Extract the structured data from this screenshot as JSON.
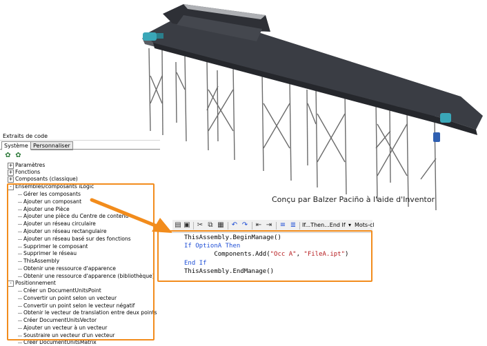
{
  "caption": "Conçu par Balzer Paciño à l'aide d'Inventor",
  "snippets_panel": {
    "title": "Extraits de code",
    "tabs": [
      "Système",
      "Personnaliser"
    ],
    "tree": [
      {
        "label": "Paramètres",
        "expander": "+"
      },
      {
        "label": "Fonctions",
        "expander": "+"
      },
      {
        "label": "Composants (classique)",
        "expander": "+"
      },
      {
        "label": "Ensembles/composants iLogic",
        "expander": "-"
      },
      {
        "label": "Gérer les composants"
      },
      {
        "label": "Ajouter un composant"
      },
      {
        "label": "Ajouter une Pièce"
      },
      {
        "label": "Ajouter une pièce du Centre de contenu"
      },
      {
        "label": "Ajouter un réseau circulaire"
      },
      {
        "label": "Ajouter un réseau rectangulaire"
      },
      {
        "label": "Ajouter un réseau basé sur des fonctions"
      },
      {
        "label": "Supprimer le composant"
      },
      {
        "label": "Supprimer le réseau"
      },
      {
        "label": "ThisAssembly"
      },
      {
        "label": "Obtenir une ressource d'apparence"
      },
      {
        "label": "Obtenir une ressource d'apparence (bibliothèque)"
      },
      {
        "label": "Positionnement",
        "expander": "-"
      },
      {
        "label": "Créer un DocumentUnitsPoint"
      },
      {
        "label": "Convertir un point selon un vecteur"
      },
      {
        "label": "Convertir un point selon le vecteur négatif"
      },
      {
        "label": "Obtenir le vecteur de translation entre deux points"
      },
      {
        "label": "Créer DocumentUnitsVector"
      },
      {
        "label": "Ajouter un vecteur à un vecteur"
      },
      {
        "label": "Soustraire un vecteur d'un vecteur"
      },
      {
        "label": "Créer DocumentUnitsMatrix"
      }
    ]
  },
  "editor": {
    "toolbar": {
      "if_then_label": "If...Then...End If",
      "keywords_label": "Mots-cl"
    },
    "code": {
      "line1": "ThisAssembly.BeginManage()",
      "line2_kw": "If",
      "line2_var": " OptionA ",
      "line2_kw2": "Then",
      "line3_pre": "        Components.Add(",
      "line3_s1": "\"Occ A\"",
      "line3_mid": ", ",
      "line3_s2": "\"FileA.ipt\"",
      "line3_post": ")",
      "line4": "End If",
      "line5": "ThisAssembly.EndManage()"
    }
  },
  "colors": {
    "highlight": "#f28c1c",
    "keyword": "#1f4fd6",
    "string": "#b5191c",
    "conveyor_belt": "#3a3d44",
    "motor": "#3aa7b8"
  },
  "icons": [
    "conveyor-render",
    "save-icon",
    "cut-icon",
    "copy-icon",
    "paste-icon",
    "undo-icon",
    "redo-icon",
    "indent-icon",
    "comment-icon",
    "dropdown-icon",
    "arrow"
  ]
}
